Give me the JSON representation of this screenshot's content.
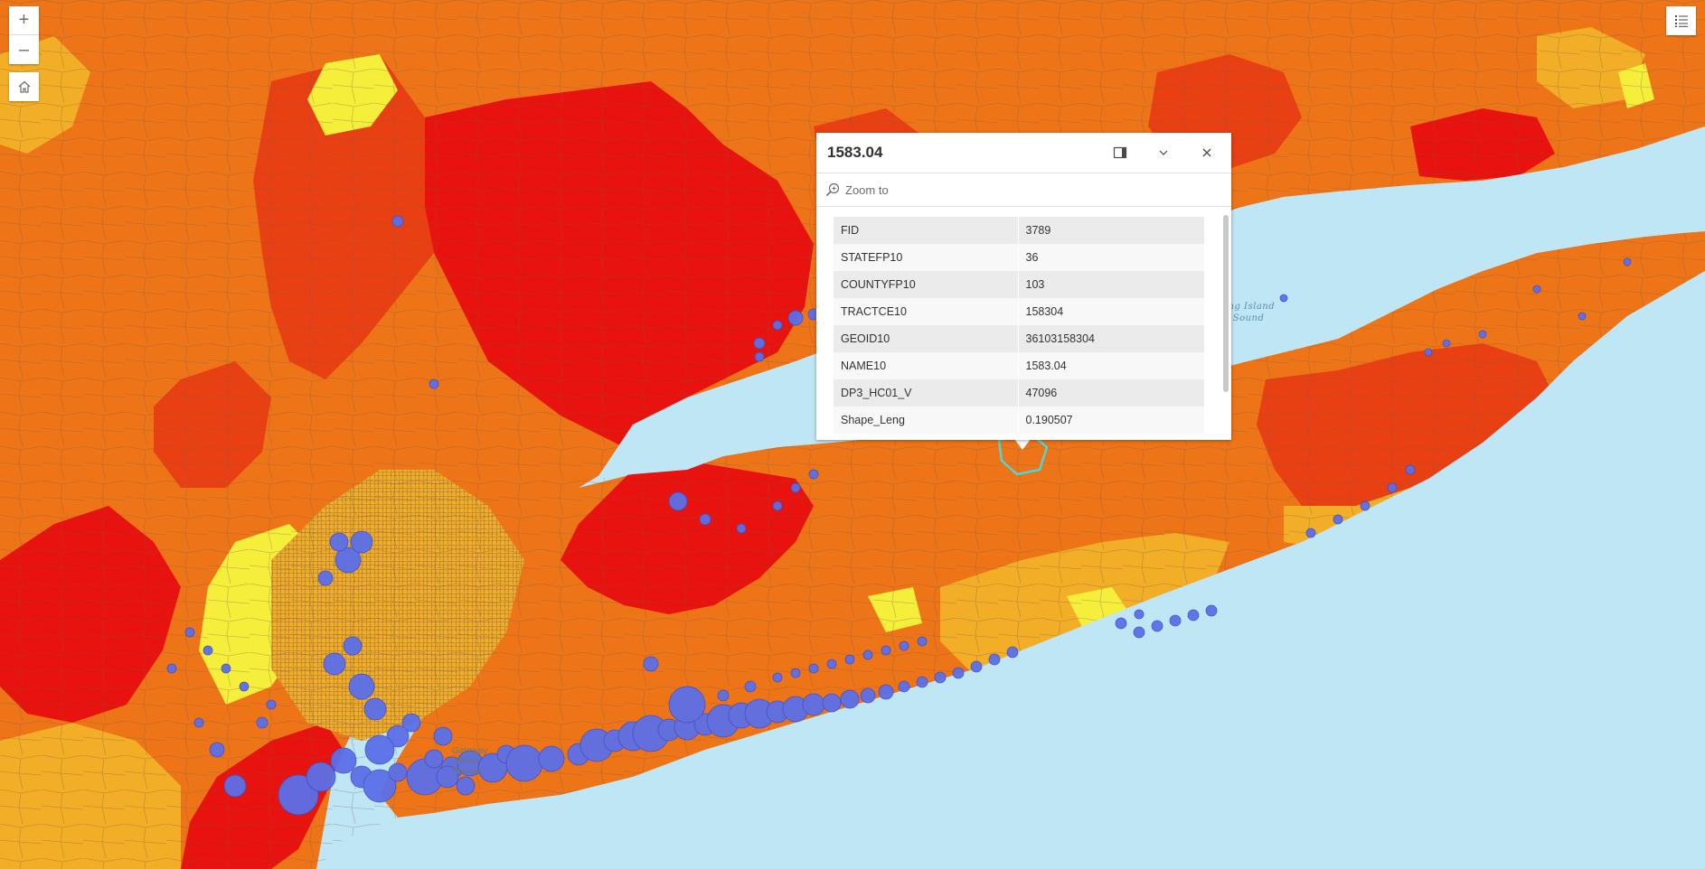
{
  "map": {
    "colors": {
      "water": "#bfe6f5",
      "class1": "#f5ef3c",
      "class2": "#f2ae26",
      "class3": "#ee7418",
      "class4": "#e84012",
      "class5": "#e8120e",
      "flood_points": "#5b6fe8",
      "boundary": "#7a5a48",
      "selected_outline": "#4fd6d6"
    },
    "water_label": "ong Island\nSound",
    "park_label": "Gateway\nNation\nRecrea"
  },
  "controls": {
    "zoom_in_icon": "plus-icon",
    "zoom_in": "+",
    "zoom_out_icon": "minus-icon",
    "zoom_out": "–",
    "home_icon": "home-icon",
    "legend_icon": "list-icon"
  },
  "popup": {
    "title": "1583.04",
    "dock_icon": "dock-icon",
    "collapse_icon": "chevron-down-icon",
    "close_icon": "close-icon",
    "zoom_to_icon": "zoom-in-icon",
    "zoom_to_label": "Zoom to",
    "fields": [
      {
        "name": "FID",
        "value": "3789"
      },
      {
        "name": "STATEFP10",
        "value": "36"
      },
      {
        "name": "COUNTYFP10",
        "value": "103"
      },
      {
        "name": "TRACTCE10",
        "value": "158304"
      },
      {
        "name": "GEOID10",
        "value": "36103158304"
      },
      {
        "name": "NAME10",
        "value": "1583.04"
      },
      {
        "name": "DP3_HC01_V",
        "value": "47096"
      },
      {
        "name": "Shape_Leng",
        "value": "0.190507"
      }
    ]
  }
}
